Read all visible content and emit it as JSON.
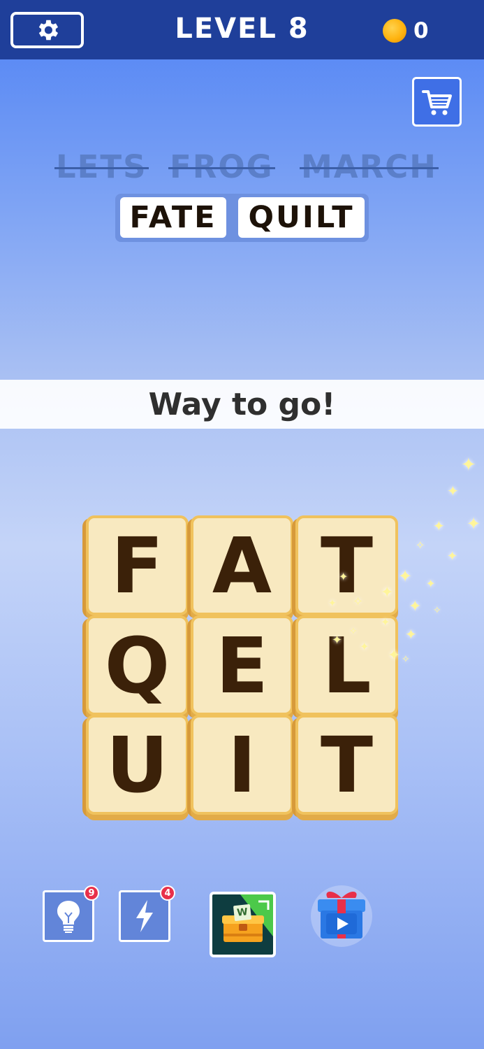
{
  "header": {
    "level_label": "LEVEL 8",
    "coins": "0"
  },
  "found_words": [
    "LETS",
    "FROG",
    "MARCH"
  ],
  "target_words": [
    "FATE",
    "QUILT"
  ],
  "banner": "Way to go!",
  "grid": [
    [
      "F",
      "A",
      "T"
    ],
    [
      "Q",
      "E",
      "L"
    ],
    [
      "U",
      "I",
      "T"
    ]
  ],
  "tools": {
    "hint_count": "9",
    "boost_count": "4"
  },
  "chest_label": "W",
  "colors": {
    "topbar": "#1f3f9a",
    "tile": "#f8e9c0",
    "tile_border": "#f0c25d",
    "letter": "#3b2109"
  }
}
